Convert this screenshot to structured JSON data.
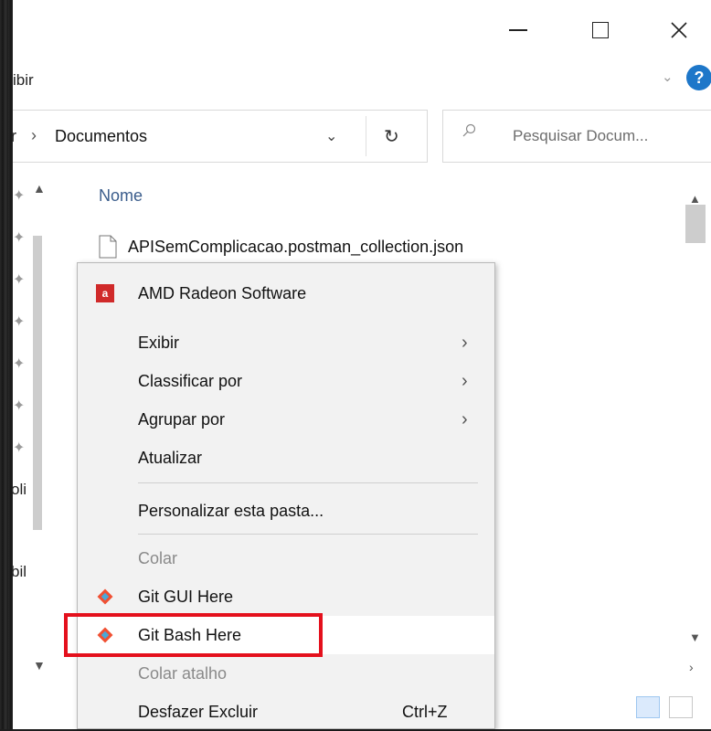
{
  "window": {
    "ribbon_tab_partial": "ibir"
  },
  "address": {
    "prev_partial": "r",
    "separator": "›",
    "current": "Documentos",
    "dropdown": "⌄",
    "refresh": "↻"
  },
  "search": {
    "placeholder": "Pesquisar Docum..."
  },
  "nav": {
    "partial_labels": [
      "oli",
      "bil"
    ]
  },
  "content": {
    "column_header": "Nome",
    "files": [
      {
        "name": "APISemComplicacao.postman_collection.json"
      }
    ]
  },
  "context_menu": {
    "items": [
      {
        "label": "AMD Radeon Software",
        "icon": "amd-icon"
      },
      {
        "label": "Exibir",
        "submenu": true
      },
      {
        "label": "Classificar por",
        "submenu": true
      },
      {
        "label": "Agrupar por",
        "submenu": true
      },
      {
        "label": "Atualizar"
      },
      {
        "label": "Personalizar esta pasta..."
      },
      {
        "label": "Colar",
        "disabled": true
      },
      {
        "label": "Git GUI Here",
        "icon": "git-icon"
      },
      {
        "label": "Git Bash Here",
        "icon": "git-icon",
        "highlighted": true
      },
      {
        "label": "Colar atalho",
        "disabled": true
      },
      {
        "label": "Desfazer Excluir",
        "shortcut": "Ctrl+Z"
      }
    ]
  },
  "colors": {
    "highlight": "#e4101c",
    "help_button": "#1e77c9",
    "column_header": "#3b5d8c"
  }
}
